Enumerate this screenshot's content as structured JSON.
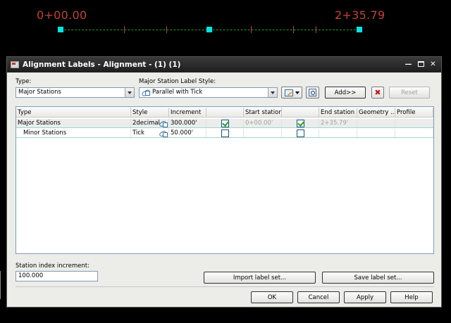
{
  "cad": {
    "start_label": "0+00.00",
    "end_label": "2+35.79"
  },
  "dialog": {
    "title": "Alignment Labels - Alignment - (1) (1)",
    "type_label": "Type:",
    "type_value": "Major Stations",
    "style_label": "Major Station Label Style:",
    "style_value": "Parallel with Tick",
    "add_button": "Add>>",
    "reset_button": "Reset",
    "grid": {
      "headers": [
        "Type",
        "Style",
        "Increment",
        "",
        "Start station",
        "",
        "End station",
        "Geometry ...",
        "Profile"
      ],
      "rows": [
        {
          "type": "Major Stations",
          "style": "2decimal",
          "increment": "300.000'",
          "start_checked": true,
          "start_station": "0+00.00'",
          "end_checked": true,
          "end_station": "2+35.79'"
        },
        {
          "type": "Minor Stations",
          "style": "Tick",
          "increment": "50.000'",
          "start_checked": false,
          "start_station": "",
          "end_checked": false,
          "end_station": ""
        }
      ]
    },
    "station_index_label": "Station index increment:",
    "station_index_value": "100.000",
    "import_button": "Import label set...",
    "save_button": "Save label set...",
    "ok_button": "OK",
    "cancel_button": "Cancel",
    "apply_button": "Apply",
    "help_button": "Help"
  },
  "colors": {
    "cad_text": "#c0413a",
    "grip": "#00e5e5",
    "alignment_line": "#2a9a2a",
    "titlebar": "#1e1e1e",
    "dialog_bg": "#ecece8"
  }
}
